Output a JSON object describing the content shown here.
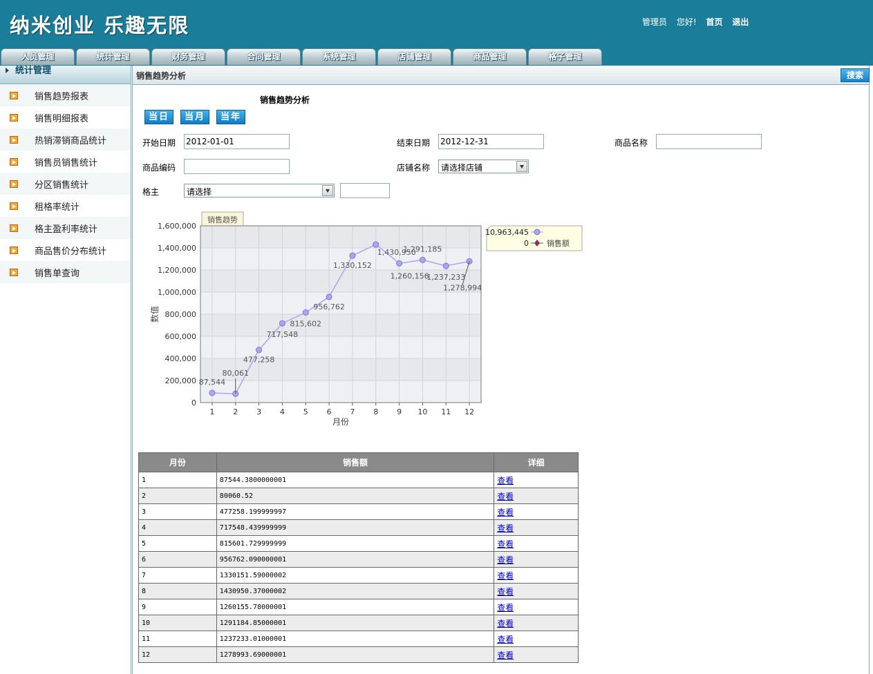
{
  "header": {
    "logo": "纳米创业 乐趣无限",
    "user_role": "管理员",
    "greeting": "您好!",
    "home": "首页",
    "logout": "退出"
  },
  "nav_tabs": [
    "人员管理",
    "统计管理",
    "财务管理",
    "合同管理",
    "系统管理",
    "店铺管理",
    "商品管理",
    "格子管理"
  ],
  "sidebar": {
    "title": "统计管理",
    "items": [
      "销售趋势报表",
      "销售明细报表",
      "热销滞销商品统计",
      "销售员销售统计",
      "分区销售统计",
      "租格率统计",
      "格主盈利率统计",
      "商品售价分布统计",
      "销售单查询"
    ]
  },
  "main": {
    "head_title": "销售趋势分析",
    "search_button": "搜索",
    "section_title": "销售趋势分析",
    "period_buttons": [
      "当日",
      "当月",
      "当年"
    ]
  },
  "form": {
    "start_date_label": "开始日期",
    "start_date_value": "2012-01-01",
    "end_date_label": "结束日期",
    "end_date_value": "2012-12-31",
    "product_name_label": "商品名称",
    "product_name_value": "",
    "product_code_label": "商品编码",
    "product_code_value": "",
    "shop_name_label": "店铺名称",
    "shop_select_value": "请选择店铺",
    "owner_label": "格主",
    "owner_select_value": "请选择",
    "owner_extra_value": ""
  },
  "chart_data": {
    "type": "line",
    "tab_label": "销售趋势",
    "x": [
      1,
      2,
      3,
      4,
      5,
      6,
      7,
      8,
      9,
      10,
      11,
      12
    ],
    "series": [
      {
        "name": "销售额",
        "values": [
          87544,
          80061,
          477258,
          717548,
          815602,
          956762,
          1330152,
          1430950,
          1260156,
          1291185,
          1237233,
          1278994
        ]
      }
    ],
    "data_labels": [
      "87,544",
      "80,061",
      "477,258",
      "717,548",
      "815,602",
      "956,762",
      "1,330,152",
      "1,430,950",
      "1,260,156",
      "1,291,185",
      "1,237,233",
      "1,278,994"
    ],
    "xlabel": "月份",
    "ylabel": "数值",
    "ylim": [
      0,
      1600000
    ],
    "yticks": [
      "0",
      "200,000",
      "400,000",
      "600,000",
      "800,000",
      "1,000,000",
      "1,200,000",
      "1,400,000",
      "1,600,000"
    ],
    "grid": true,
    "legend": {
      "position": "right",
      "entries": [
        {
          "value": "10,963,445",
          "label": ""
        },
        {
          "value": "0",
          "label": "销售额"
        }
      ]
    },
    "colors": {
      "line": "#a7a7ee",
      "marker": "#a8a8f0",
      "plot_bg": "#e6e8ec",
      "tab_bg": "#fbf6d9",
      "legend_bg": "#fffde3"
    }
  },
  "table": {
    "headers": [
      "月份",
      "销售额",
      "详细"
    ],
    "link_text": "查看",
    "rows": [
      [
        "1",
        "87544.3800000001"
      ],
      [
        "2",
        "80060.52"
      ],
      [
        "3",
        "477258.199999997"
      ],
      [
        "4",
        "717548.439999999"
      ],
      [
        "5",
        "815601.729999999"
      ],
      [
        "6",
        "956762.090000001"
      ],
      [
        "7",
        "1330151.59000002"
      ],
      [
        "8",
        "1430950.37000002"
      ],
      [
        "9",
        "1260155.78000001"
      ],
      [
        "10",
        "1291184.85000001"
      ],
      [
        "11",
        "1237233.01000001"
      ],
      [
        "12",
        "1278993.69000001"
      ]
    ]
  }
}
